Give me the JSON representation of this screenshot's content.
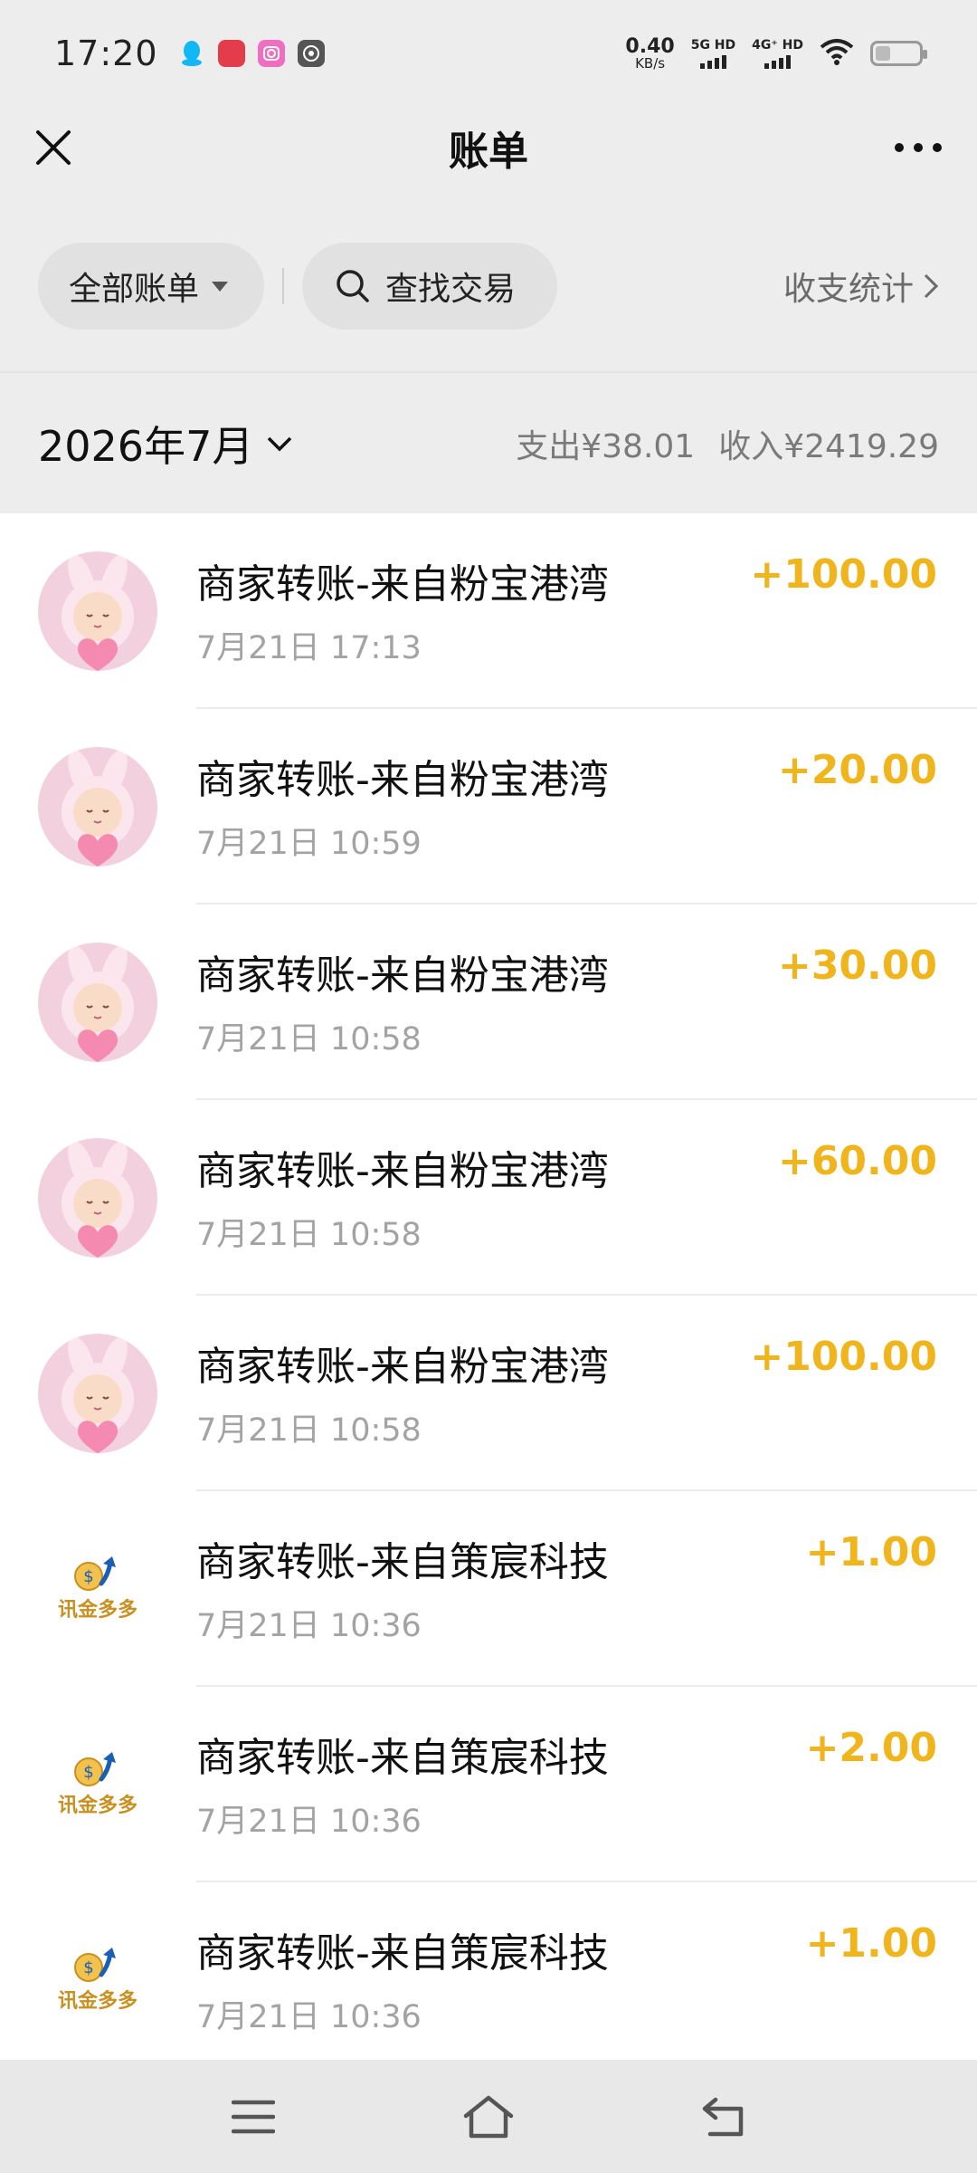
{
  "status_bar": {
    "time": "17:20",
    "net_speed_value": "0.40",
    "net_speed_unit": "KB/s",
    "signal1_label": "5G HD",
    "signal2_label": "4G⁺ HD"
  },
  "nav": {
    "title": "账单",
    "close_icon": "close-icon",
    "more_icon": "more-dots-icon"
  },
  "filters": {
    "all_bills_label": "全部账单",
    "search_label": "查找交易",
    "stats_label": "收支统计"
  },
  "month": {
    "label": "2026年7月",
    "expense": "支出¥38.01",
    "income": "收入¥2419.29"
  },
  "colors": {
    "amount": "#f0b51c",
    "background": "#ededed"
  },
  "transactions": [
    {
      "title": "商家转账-来自粉宝港湾",
      "time": "7月21日 17:13",
      "amount": "+100.00",
      "avatar": "pink-bunny-avatar"
    },
    {
      "title": "商家转账-来自粉宝港湾",
      "time": "7月21日 10:59",
      "amount": "+20.00",
      "avatar": "pink-bunny-avatar"
    },
    {
      "title": "商家转账-来自粉宝港湾",
      "time": "7月21日 10:58",
      "amount": "+30.00",
      "avatar": "pink-bunny-avatar"
    },
    {
      "title": "商家转账-来自粉宝港湾",
      "time": "7月21日 10:58",
      "amount": "+60.00",
      "avatar": "pink-bunny-avatar"
    },
    {
      "title": "商家转账-来自粉宝港湾",
      "time": "7月21日 10:58",
      "amount": "+100.00",
      "avatar": "pink-bunny-avatar"
    },
    {
      "title": "商家转账-来自策宸科技",
      "time": "7月21日 10:36",
      "amount": "+1.00",
      "avatar": "xunjin-logo",
      "logo_text": "讯金多多"
    },
    {
      "title": "商家转账-来自策宸科技",
      "time": "7月21日 10:36",
      "amount": "+2.00",
      "avatar": "xunjin-logo",
      "logo_text": "讯金多多"
    },
    {
      "title": "商家转账-来自策宸科技",
      "time": "7月21日 10:36",
      "amount": "+1.00",
      "avatar": "xunjin-logo",
      "logo_text": "讯金多多"
    }
  ],
  "system_nav": {
    "menu_icon": "menu-icon",
    "home_icon": "home-icon",
    "back_icon": "back-icon"
  }
}
